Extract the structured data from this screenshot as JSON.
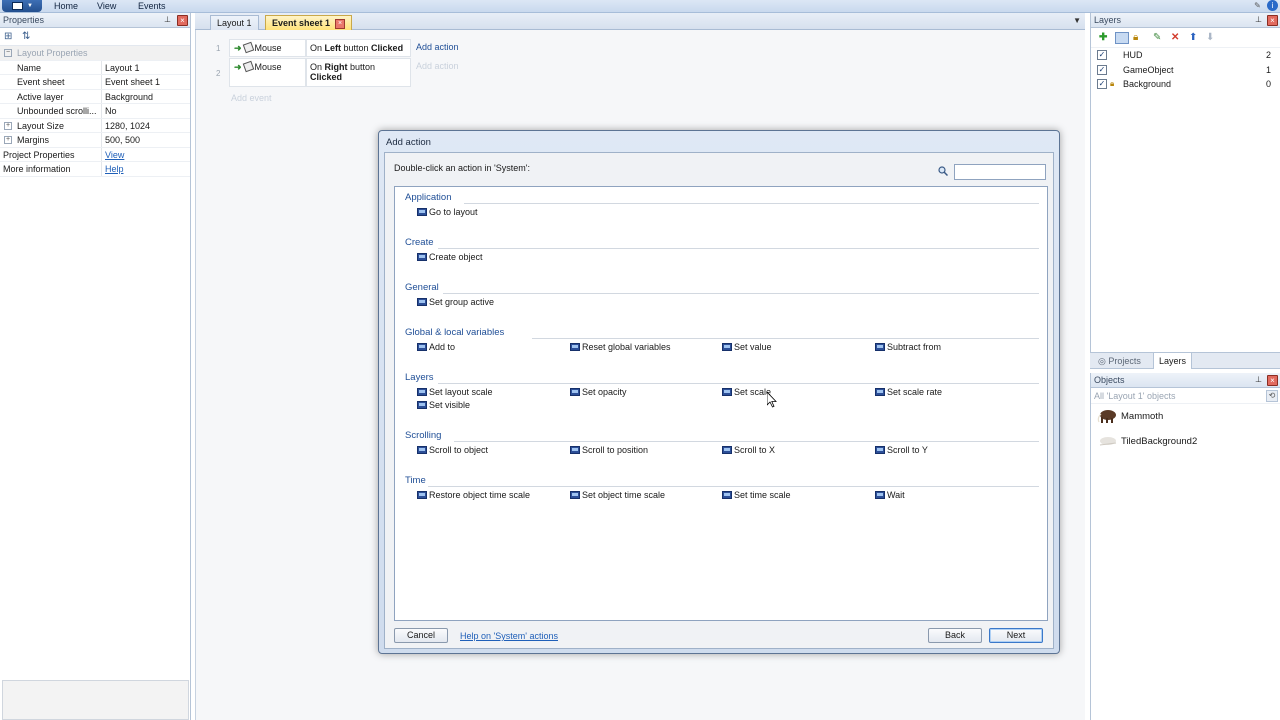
{
  "ribbon": {
    "tabs": [
      "Home",
      "View",
      "Events"
    ]
  },
  "properties": {
    "title": "Properties",
    "category": "Layout Properties",
    "rows": [
      {
        "key": "Name",
        "value": "Layout 1"
      },
      {
        "key": "Event sheet",
        "value": "Event sheet 1"
      },
      {
        "key": "Active layer",
        "value": "Background"
      },
      {
        "key": "Unbounded scrolli...",
        "value": "No"
      },
      {
        "key": "Layout Size",
        "value": "1280, 1024"
      },
      {
        "key": "Margins",
        "value": "500, 500"
      },
      {
        "key": "Project Properties",
        "value": "View"
      },
      {
        "key": "More information",
        "value": "Help"
      }
    ]
  },
  "doc_tabs": {
    "tabs": [
      "Layout 1",
      "Event sheet 1"
    ],
    "active": "Event sheet 1"
  },
  "event_sheet": {
    "events": [
      {
        "num": "1",
        "object": "Mouse",
        "cond_pre": "On ",
        "cond_bold": "Left",
        "cond_mid": " button ",
        "cond_bold2": "Clicked",
        "action": "Add action"
      },
      {
        "num": "2",
        "object": "Mouse",
        "cond_pre": "On ",
        "cond_bold": "Right",
        "cond_mid": " button",
        "cond_bold2": "Clicked",
        "action": "Add action"
      }
    ],
    "add_event": "Add event"
  },
  "layers": {
    "title": "Layers",
    "items": [
      {
        "name": "HUD",
        "index": "2",
        "locked": false
      },
      {
        "name": "GameObject",
        "index": "1",
        "locked": false
      },
      {
        "name": "Background",
        "index": "0",
        "locked": true
      }
    ]
  },
  "right_tabs": [
    "Projects",
    "Layers"
  ],
  "objects": {
    "title": "Objects",
    "filter": "All 'Layout 1' objects",
    "items": [
      "Mammoth",
      "TiledBackground2"
    ]
  },
  "dialog": {
    "title": "Add action",
    "instruction": "Double-click an action in 'System':",
    "search_value": "",
    "categories": [
      {
        "name": "Application",
        "actions": [
          "Go to layout"
        ]
      },
      {
        "name": "Create",
        "actions": [
          "Create object"
        ]
      },
      {
        "name": "General",
        "actions": [
          "Set group active"
        ]
      },
      {
        "name": "Global & local variables",
        "actions": [
          "Add to",
          "Reset global variables",
          "Set value",
          "Subtract from"
        ]
      },
      {
        "name": "Layers",
        "actions": [
          "Set layout scale",
          "Set opacity",
          "Set scale",
          "Set scale rate",
          "Set visible"
        ]
      },
      {
        "name": "Scrolling",
        "actions": [
          "Scroll to object",
          "Scroll to position",
          "Scroll to X",
          "Scroll to Y"
        ]
      },
      {
        "name": "Time",
        "actions": [
          "Restore object time scale",
          "Set object time scale",
          "Set time scale",
          "Wait"
        ]
      }
    ],
    "cancel": "Cancel",
    "help_link": "Help on 'System' actions",
    "back": "Back",
    "next": "Next"
  },
  "colors": {
    "accent": "#1f4e96",
    "active_tab": "#ffe27a"
  }
}
